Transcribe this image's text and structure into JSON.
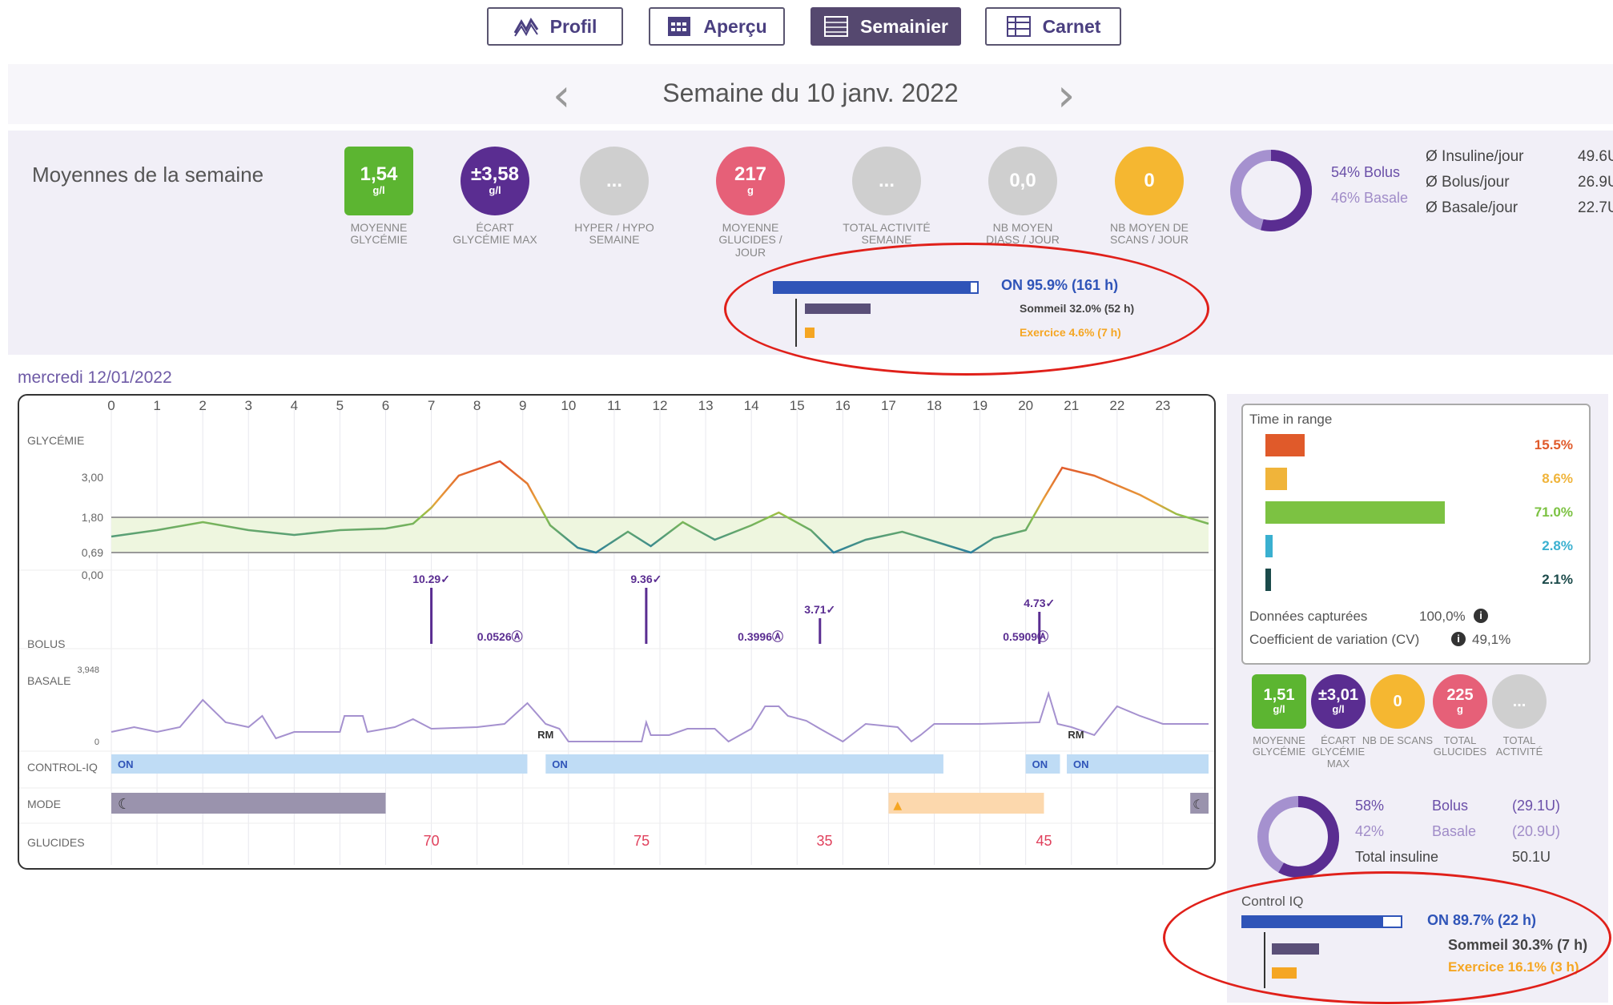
{
  "nav": {
    "tabs": [
      {
        "label": "Profil"
      },
      {
        "label": "Aperçu"
      },
      {
        "label": "Semainier"
      },
      {
        "label": "Carnet"
      }
    ],
    "active": "Semainier"
  },
  "week": {
    "title": "Semaine du 10 janv. 2022"
  },
  "averages": {
    "label": "Moyennes de la semaine",
    "stats": [
      {
        "value": "1,54",
        "unit": "g/l",
        "caption": "MOYENNE GLYCÉMIE",
        "color": "#5cb531"
      },
      {
        "value": "±3,58",
        "unit": "g/l",
        "caption": "ÉCART GLYCÉMIE MAX",
        "color": "#5a2d91"
      },
      {
        "value": "...",
        "unit": "",
        "caption": "HYPER / HYPO SEMAINE",
        "color": "#cfcfcf"
      },
      {
        "value": "217",
        "unit": "g",
        "caption": "MOYENNE GLUCIDES / JOUR",
        "color": "#e66078"
      },
      {
        "value": "...",
        "unit": "",
        "caption": "TOTAL ACTIVITÉ SEMAINE",
        "color": "#cfcfcf"
      },
      {
        "value": "0,0",
        "unit": "",
        "caption": "NB MOYEN DIASS / JOUR",
        "color": "#cfcfcf"
      },
      {
        "value": "0",
        "unit": "",
        "caption": "NB MOYEN DE SCANS / JOUR",
        "color": "#f5b731"
      }
    ],
    "bolus_pct": "54% Bolus",
    "basale_pct": "46% Basale",
    "bolus_fraction": 0.54,
    "insulin": [
      {
        "label": "Ø Insuline/jour",
        "value": "49.6U"
      },
      {
        "label": "Ø Bolus/jour",
        "value": "26.9U"
      },
      {
        "label": "Ø Basale/jour",
        "value": "22.7U"
      }
    ],
    "controliq": {
      "on": "ON 95.9% (161 h)",
      "on_fraction": 0.959,
      "sommeil": "Sommeil 32.0% (52 h)",
      "sommeil_fraction": 0.32,
      "exercice": "Exercice 4.6% (7 h)",
      "exercice_fraction": 0.046
    }
  },
  "day": {
    "label": "mercredi 12/01/2022",
    "hours": [
      "0",
      "1",
      "2",
      "3",
      "4",
      "5",
      "6",
      "7",
      "8",
      "9",
      "10",
      "11",
      "12",
      "13",
      "14",
      "15",
      "16",
      "17",
      "18",
      "19",
      "20",
      "21",
      "22",
      "23"
    ],
    "row_labels": {
      "glycemie": "GLYCÉMIE",
      "bolus": "BOLUS",
      "basale": "BASALE",
      "controliq": "CONTROL-IQ",
      "mode": "MODE",
      "glucides": "GLUCIDES"
    },
    "y_ticks": [
      "3,00",
      "1,80",
      "0,69",
      "0,00"
    ],
    "basale_max": "3,948",
    "basale_min": "0",
    "boluses": [
      {
        "hour": 7.0,
        "label": "10.29✓",
        "type": "main"
      },
      {
        "hour": 8.5,
        "label": "0.0526Ⓐ",
        "type": "auto"
      },
      {
        "hour": 11.7,
        "label": "9.36✓",
        "type": "main"
      },
      {
        "hour": 14.2,
        "label": "0.3996Ⓐ",
        "type": "auto"
      },
      {
        "hour": 15.5,
        "label": "3.71✓",
        "type": "main"
      },
      {
        "hour": 20.3,
        "label": "4.73✓",
        "type": "main"
      },
      {
        "hour": 20.0,
        "label": "0.5909Ⓐ",
        "type": "auto"
      }
    ],
    "rm_labels": [
      {
        "hour": 9.5,
        "label": "RM"
      },
      {
        "hour": 21.1,
        "label": "RM"
      }
    ],
    "controliq_segments": [
      {
        "start": 0,
        "end": 9.1,
        "label": "ON"
      },
      {
        "start": 9.5,
        "end": 18.2,
        "label": "ON"
      },
      {
        "start": 20.0,
        "end": 20.75,
        "label": "ON"
      },
      {
        "start": 20.9,
        "end": 24,
        "label": "ON"
      }
    ],
    "glucides": [
      {
        "hour": 7.0,
        "value": "70"
      },
      {
        "hour": 11.6,
        "value": "75"
      },
      {
        "hour": 15.6,
        "value": "35"
      },
      {
        "hour": 20.4,
        "value": "45"
      }
    ]
  },
  "right": {
    "tir_title": "Time in range",
    "tir": [
      {
        "value": "15.5%",
        "fraction": 0.155,
        "color": "#e05a2a"
      },
      {
        "value": "8.6%",
        "fraction": 0.086,
        "color": "#f0b43a"
      },
      {
        "value": "71.0%",
        "fraction": 0.71,
        "color": "#7cc242"
      },
      {
        "value": "2.8%",
        "fraction": 0.028,
        "color": "#3ab0d0"
      },
      {
        "value": "2.1%",
        "fraction": 0.021,
        "color": "#1b4a4a"
      }
    ],
    "captured_label": "Données capturées",
    "captured_value": "100,0%",
    "cv_label": "Coefficient de variation (CV)",
    "cv_value": "49,1%",
    "stats": [
      {
        "value": "1,51",
        "unit": "g/l",
        "caption": "MOYENNE GLYCÉMIE",
        "color": "#5cb531"
      },
      {
        "value": "±3,01",
        "unit": "g/l",
        "caption": "ÉCART GLYCÉMIE MAX",
        "color": "#5a2d91"
      },
      {
        "value": "0",
        "unit": "",
        "caption": "NB DE SCANS",
        "color": "#f5b731"
      },
      {
        "value": "225",
        "unit": "g",
        "caption": "TOTAL GLUCIDES",
        "color": "#e66078"
      },
      {
        "value": "...",
        "unit": "",
        "caption": "TOTAL ACTIVITÉ",
        "color": "#cfcfcf"
      }
    ],
    "bolus_pct": "58%",
    "bolus_label": "Bolus",
    "bolus_units": "(29.1U)",
    "basale_pct": "42%",
    "basale_label": "Basale",
    "basale_units": "(20.9U)",
    "total_label": "Total insuline",
    "total_value": "50.1U",
    "bolus_fraction": 0.58,
    "controliq_title": "Control IQ",
    "controliq": {
      "on": "ON 89.7% (22 h)",
      "on_fraction": 0.897,
      "sommeil": "Sommeil 30.3% (7 h)",
      "sommeil_fraction": 0.303,
      "exercice": "Exercice 16.1% (3 h)",
      "exercice_fraction": 0.161
    }
  }
}
